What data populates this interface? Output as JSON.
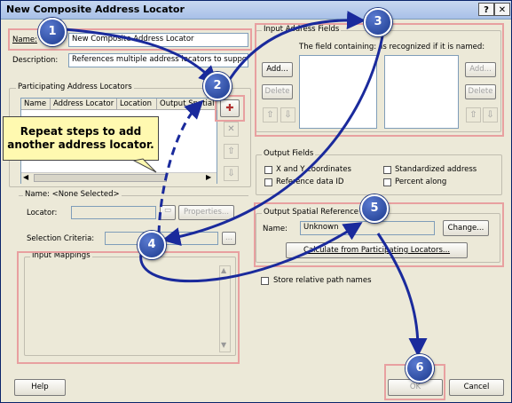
{
  "window": {
    "title": "New Composite Address Locator",
    "help_icon": "?",
    "close_icon": "✕"
  },
  "name": {
    "label": "Name:",
    "value": "New Composite Address Locator"
  },
  "description": {
    "label": "Description:",
    "value": "References multiple address locators to support ge"
  },
  "participating": {
    "group_label": "Participating Address Locators",
    "columns": [
      "Name",
      "Address Locator",
      "Location",
      "Output Spatial R"
    ]
  },
  "selected": {
    "name_label": "Name: <None Selected>",
    "locator_label": "Locator:",
    "properties_button": "Properties...",
    "selection_criteria_label": "Selection Criteria:",
    "ellipsis_button": "..."
  },
  "input_mappings": {
    "group_label": "Input Mappings"
  },
  "input_address_fields": {
    "group_label": "Input Address Fields",
    "field_containing_label": "The field containing:",
    "recognized_label": "is recognized if it is named:",
    "add_button": "Add...",
    "delete_button": "Delete",
    "add_button_right": "Add...",
    "delete_button_right": "Delete"
  },
  "output_fields": {
    "group_label": "Output Fields",
    "options": [
      "X and Y coordinates",
      "Reference data ID",
      "Standardized address",
      "Percent along"
    ]
  },
  "spatial_ref": {
    "group_label": "Output Spatial Reference",
    "name_label": "Name:",
    "name_value": "Unknown",
    "change_button": "Change...",
    "calculate_button": "Calculate from Participating Locators..."
  },
  "store_relative": {
    "label": "Store relative path names"
  },
  "buttons": {
    "help": "Help",
    "ok": "OK",
    "cancel": "Cancel"
  },
  "callout": {
    "text_line1": "Repeat steps to add",
    "text_line2": "another address locator."
  },
  "steps": [
    "1",
    "2",
    "3",
    "4",
    "5",
    "6"
  ],
  "colors": {
    "step_circle": "#1c3a8e",
    "arrow": "#1a2a9c",
    "highlight": "#e8a0a0",
    "callout_bg": "#fff9b0"
  }
}
